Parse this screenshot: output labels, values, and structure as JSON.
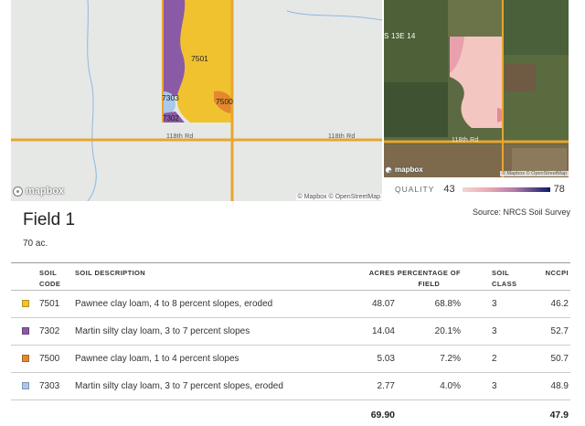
{
  "map_left": {
    "road_label_1": "118th Rd",
    "road_label_2": "118th Rd",
    "soil_labels": [
      "7501",
      "7303",
      "7500",
      "7302"
    ],
    "logo": "mapbox",
    "attribution": "© Mapbox © OpenStreetMap"
  },
  "map_right": {
    "top_label": "S 13E 14",
    "road_label": "118th Rd",
    "logo": "mapbox",
    "attribution": "© Mapbox © OpenStreetMap"
  },
  "quality": {
    "label": "QUALITY",
    "min": "43",
    "max": "78"
  },
  "source": "Source: NRCS Soil Survey",
  "field": {
    "title": "Field 1",
    "acres": "70 ac."
  },
  "table": {
    "headers": {
      "soil_code_1": "SOIL",
      "soil_code_2": "CODE",
      "description": "SOIL DESCRIPTION",
      "acres": "ACRES",
      "pct_1": "PERCENTAGE OF",
      "pct_2": "FIELD",
      "class_1": "SOIL",
      "class_2": "CLASS",
      "nccpi": "NCCPI"
    },
    "rows": [
      {
        "color": "#f0c230",
        "code": "7501",
        "description": "Pawnee clay loam, 4 to 8 percent slopes, eroded",
        "acres": "48.07",
        "pct": "68.8%",
        "class": "3",
        "nccpi": "46.2"
      },
      {
        "color": "#8b5aa6",
        "code": "7302",
        "description": "Martin silty clay loam, 3 to 7 percent slopes",
        "acres": "14.04",
        "pct": "20.1%",
        "class": "3",
        "nccpi": "52.7"
      },
      {
        "color": "#e3882e",
        "code": "7500",
        "description": "Pawnee clay loam, 1 to 4 percent slopes",
        "acres": "5.03",
        "pct": "7.2%",
        "class": "2",
        "nccpi": "50.7"
      },
      {
        "color": "#a9c8ea",
        "code": "7303",
        "description": "Martin silty clay loam, 3 to 7 percent slopes, eroded",
        "acres": "2.77",
        "pct": "4.0%",
        "class": "3",
        "nccpi": "48.9"
      }
    ],
    "totals": {
      "acres": "69.90",
      "nccpi": "47.9"
    }
  },
  "colors": {
    "road": "#e8a630",
    "water": "#8fb8df",
    "quality_low": "#f5d6cf",
    "quality_high": "#0e1a6b"
  }
}
